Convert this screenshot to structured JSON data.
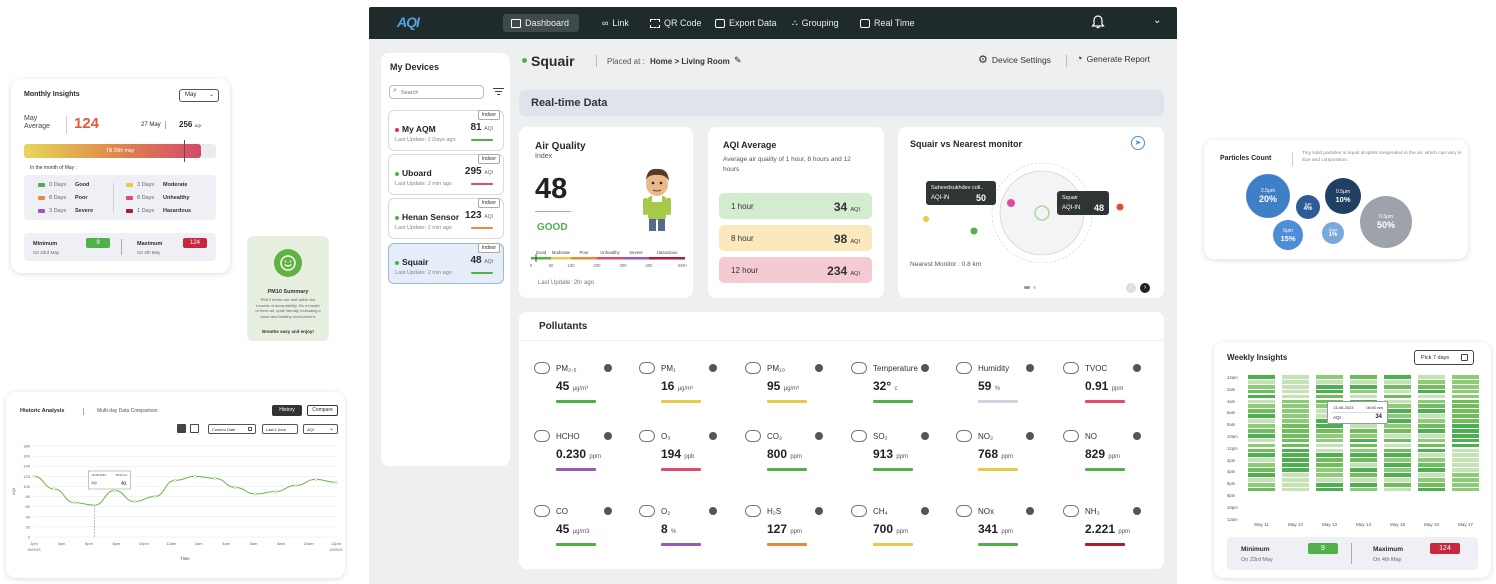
{
  "monthly": {
    "title": "Monthly Insights",
    "select": "May",
    "month_label": "May",
    "avg_label": "Average",
    "avg_value": "124",
    "date": "27 May",
    "date_value": "256",
    "aqi_unit": "AQI",
    "bar_label": "Till 29th may",
    "in_month": "In the month of May :",
    "legend": [
      {
        "days": "0 Days",
        "label": "Good",
        "color": "#4caf50"
      },
      {
        "days": "3 Days",
        "label": "Moderate",
        "color": "#e8c94a"
      },
      {
        "days": "8 Days",
        "label": "Poor",
        "color": "#e88a3a"
      },
      {
        "days": "8 Days",
        "label": "Unhealthy",
        "color": "#e04b6a"
      },
      {
        "days": "3 Days",
        "label": "Severe",
        "color": "#9c59b3"
      },
      {
        "days": "1 Days",
        "label": "Hazardous",
        "color": "#b11b33"
      }
    ],
    "min_label": "Minimum",
    "min_value": "9",
    "min_date": "On 23rd May",
    "max_label": "Maximum",
    "max_value": "124",
    "max_date": "On 4th May"
  },
  "pm10": {
    "title": "PM10 Summary",
    "text": "PM10 levels are well within the bounds of acceptability. It's a breath of fresh air, quite literally, indicating a clean and healthy environment.",
    "tagline": "Breathe easy and enjoy!"
  },
  "historic": {
    "title": "Historic Analysis",
    "subtitle": "Multi-day Data Comparison",
    "btn_history": "History",
    "btn_compare": "Compare",
    "custom_date": "Custom Date",
    "interval": "Last 1 hour",
    "param": "AQI",
    "xlabel": "Time",
    "tooltip_time": "08:00 am",
    "tooltip_date": "16-08-2023",
    "tooltip_label": "AQI",
    "tooltip_value": "61",
    "date_start": "16/09/23",
    "date_end": "10/09/23"
  },
  "nav": {
    "logo": "AQI",
    "items": [
      "Dashboard",
      "Link",
      "QR Code",
      "Export Data",
      "Grouping",
      "Real Time"
    ]
  },
  "devices": {
    "title": "My Devices",
    "search_placeholder": "Search",
    "list": [
      {
        "name": "My AQM",
        "badge": "Indoor",
        "update": "Last Update: 2 Days ago",
        "value": "81",
        "unit": "AQI",
        "dot": "#d6344f",
        "bar": "#52b04a"
      },
      {
        "name": "Uboard",
        "badge": "Indoor",
        "update": "Last Update: 2 min ago",
        "value": "295",
        "unit": "AQI",
        "dot": "#52b04a",
        "bar": "#e04b6a"
      },
      {
        "name": "Henan Sensor",
        "badge": "Indoor",
        "update": "Last Update: 2 min ago",
        "value": "123",
        "unit": "AQI",
        "dot": "#52b04a",
        "bar": "#e88a3a"
      },
      {
        "name": "Squair",
        "badge": "Indoor",
        "update": "Last Update: 2 min ago",
        "value": "48",
        "unit": "AQI",
        "dot": "#52b04a",
        "bar": "#52b04a"
      }
    ]
  },
  "header": {
    "device": "Squair",
    "placed_label": "Placed at :",
    "location": "Home > Living Room",
    "settings": "Device Settings",
    "report": "Generate Report"
  },
  "realtime_title": "Real-time Data",
  "airq": {
    "title": "Air Quality",
    "subtitle": "Index",
    "value": "48",
    "status": "GOOD",
    "last_update": "Last Update: 2hr ago",
    "scale_labels": [
      "Good",
      "Moderate",
      "Poor",
      "Unhealthy",
      "Severe",
      "Hazardous"
    ],
    "scale_ticks": [
      "0",
      "50",
      "100",
      "200",
      "300",
      "400",
      "500+"
    ]
  },
  "aqiavg": {
    "title": "AQI Average",
    "desc": "Average air quality of 1 hour, 8 hours and 12 hours",
    "rows": [
      {
        "label": "1 hour",
        "value": "34",
        "unit": "AQI",
        "bg": "#d3ebcf"
      },
      {
        "label": "8 hour",
        "value": "98",
        "unit": "AQI",
        "bg": "#f9e9bd"
      },
      {
        "label": "12 hour",
        "value": "234",
        "unit": "AQI",
        "bg": "#f4cbd3"
      }
    ]
  },
  "nearest": {
    "title": "Squair vs Nearest monitor",
    "station": "Saheedsukhdev coll..",
    "station_label": "AQI-IN",
    "station_value": "50",
    "me": "Squair",
    "me_label": "AQI-IN",
    "me_value": "48",
    "distance": "Nearest Monitor : 0.8 km"
  },
  "pollutants": {
    "title": "Pollutants",
    "items": [
      {
        "name": "PM₂.₅",
        "value": "45",
        "unit": "μg/m³",
        "bar": "#52b04a"
      },
      {
        "name": "PM₁",
        "value": "16",
        "unit": "μg/m³",
        "bar": "#e8c94a"
      },
      {
        "name": "PM₁₀",
        "value": "95",
        "unit": "μg/m³",
        "bar": "#e8c94a"
      },
      {
        "name": "Temperature",
        "value": "32°",
        "unit": "c",
        "bar": "#52b04a"
      },
      {
        "name": "Humidity",
        "value": "59",
        "unit": "%",
        "bar": "#d0d4e0"
      },
      {
        "name": "TVOC",
        "value": "0.91",
        "unit": "ppm",
        "bar": "#e04b6a"
      },
      {
        "name": "HCHO",
        "value": "0.230",
        "unit": "ppm",
        "bar": "#9c59b3"
      },
      {
        "name": "O₃",
        "value": "194",
        "unit": "ppb",
        "bar": "#e04b6a"
      },
      {
        "name": "CO₂",
        "value": "800",
        "unit": "ppm",
        "bar": "#52b04a"
      },
      {
        "name": "SO₂",
        "value": "913",
        "unit": "ppm",
        "bar": "#52b04a"
      },
      {
        "name": "NO₂",
        "value": "768",
        "unit": "ppm",
        "bar": "#e8c94a"
      },
      {
        "name": "NO",
        "value": "829",
        "unit": "ppm",
        "bar": "#52b04a"
      },
      {
        "name": "CO",
        "value": "45",
        "unit": "μg/m3",
        "bar": "#52b04a"
      },
      {
        "name": "O₂",
        "value": "8",
        "unit": "%",
        "bar": "#9c59b3"
      },
      {
        "name": "H₂S",
        "value": "127",
        "unit": "ppm",
        "bar": "#e88a3a"
      },
      {
        "name": "CH₄",
        "value": "700",
        "unit": "ppm",
        "bar": "#e8c94a"
      },
      {
        "name": "NOx",
        "value": "341",
        "unit": "ppm",
        "bar": "#52b04a"
      },
      {
        "name": "NH₃",
        "value": "2.221",
        "unit": "ppm",
        "bar": "#b11b33"
      }
    ]
  },
  "particles": {
    "title": "Particles Count",
    "desc": "Tiny solid particles or liquid droplets suspended in the air, which can vary in size and composition.",
    "items": [
      {
        "size": "2.5μm",
        "pct": "20%",
        "color": "#3f7fc7"
      },
      {
        "size": "1μm",
        "pct": "4%",
        "color": "#2d5d97"
      },
      {
        "size": "0.5μm",
        "pct": "10%",
        "color": "#1f3f63"
      },
      {
        "size": "5μm",
        "pct": "15%",
        "color": "#4e8ed6"
      },
      {
        "size": "10μm",
        "pct": "1%",
        "color": "#7aa9dc"
      },
      {
        "size": "0.3μm",
        "pct": "50%",
        "color": "#9ea3ab"
      }
    ]
  },
  "weekly": {
    "title": "Weekly Insights",
    "pick": "Pick 7 days",
    "hours": [
      "12am",
      "2am",
      "4am",
      "6am",
      "8am",
      "10am",
      "12pm",
      "2pm",
      "4pm",
      "6pm",
      "8pm",
      "10pm",
      "12am"
    ],
    "days": [
      "May 11",
      "May 12",
      "May 13",
      "May 14",
      "May 15",
      "May 16",
      "May 17"
    ],
    "tooltip_date": "13-08-2023",
    "tooltip_time": "08:00 am",
    "tooltip_label": "AQI",
    "tooltip_value": "34",
    "min_label": "Minimum",
    "min_value": "9",
    "min_date": "On 23rd May",
    "max_label": "Maximum",
    "max_value": "124",
    "max_date": "On 4th May"
  },
  "chart_data": {
    "type": "line",
    "series": [
      {
        "values": [
          [
            0,
            120
          ],
          [
            1,
            95
          ],
          [
            2,
            68
          ],
          [
            3,
            63
          ],
          [
            4,
            92
          ],
          [
            5,
            70
          ],
          [
            6,
            80
          ],
          [
            7,
            112
          ],
          [
            8,
            120
          ],
          [
            9,
            116
          ],
          [
            10,
            98
          ],
          [
            11,
            85
          ],
          [
            12,
            90
          ],
          [
            13,
            102
          ],
          [
            14,
            114
          ],
          [
            15,
            108
          ]
        ]
      }
    ],
    "ylim": [
      0,
      180
    ],
    "yticks": [
      "0",
      "20",
      "40",
      "60",
      "80",
      "100",
      "120",
      "140",
      "160",
      "180"
    ],
    "xticks": [
      "2pm",
      "4pm",
      "6pm",
      "8pm",
      "10pm",
      "12am",
      "2am",
      "4am",
      "6am",
      "8am",
      "10am",
      "12pm"
    ],
    "xlabel": "Time",
    "ylabel": "AQI",
    "grid": true
  }
}
